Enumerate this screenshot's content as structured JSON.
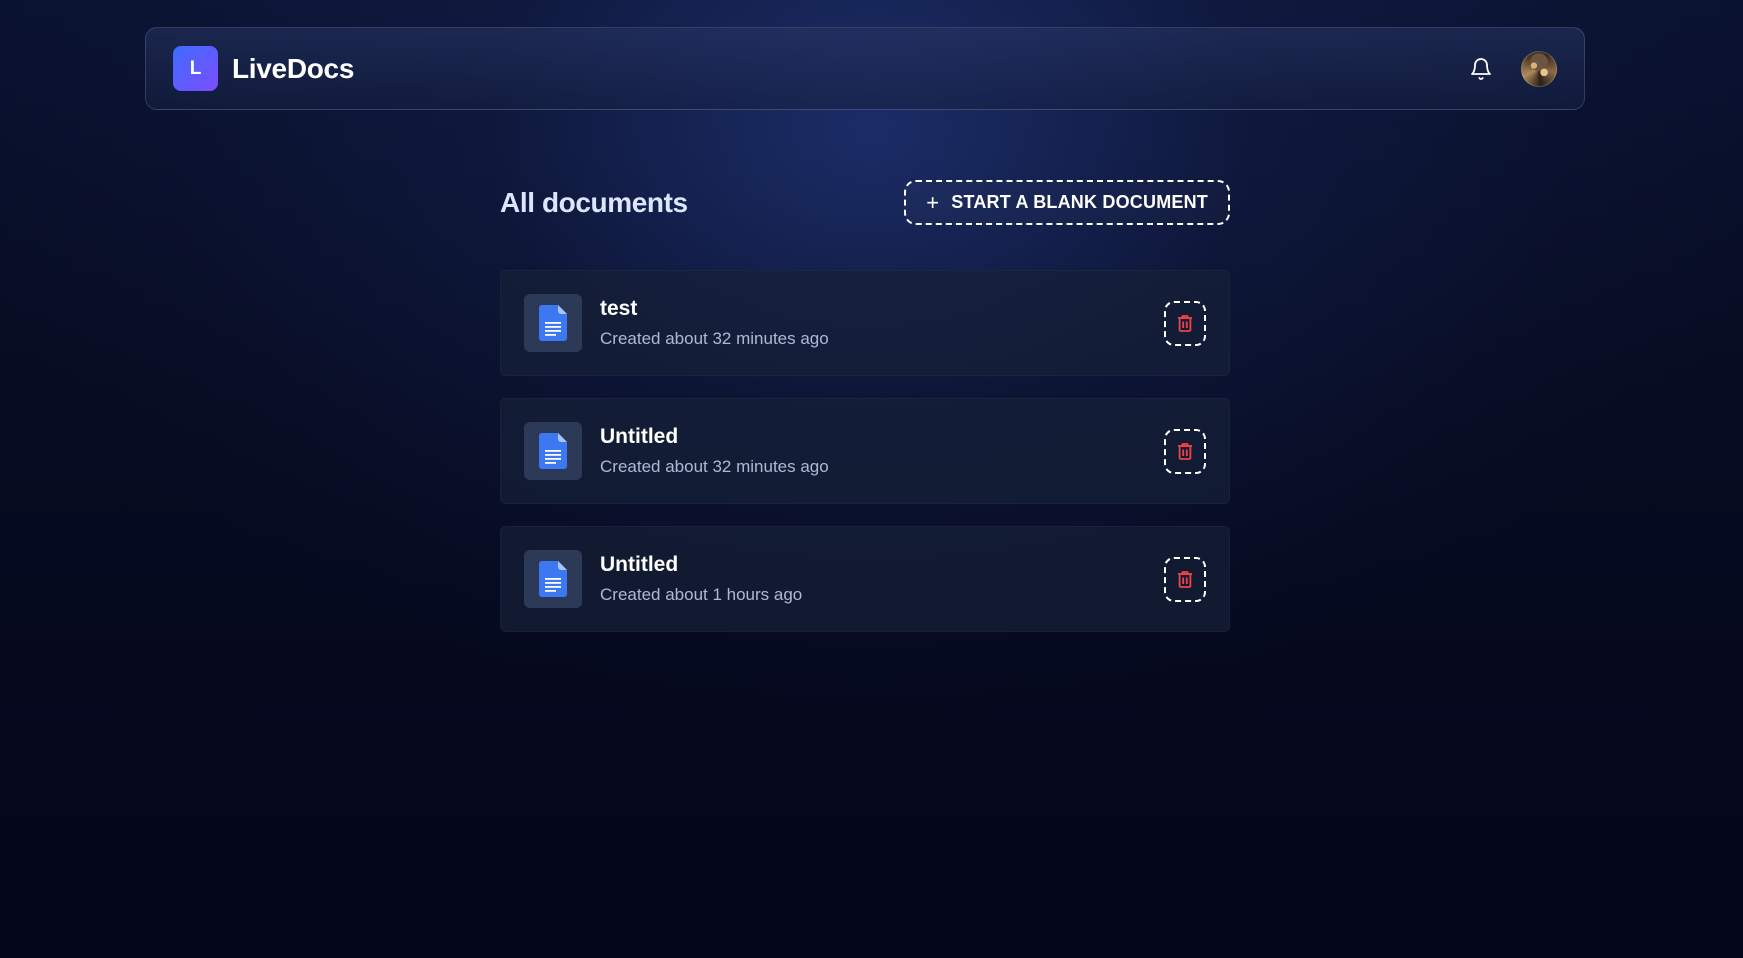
{
  "app": {
    "logo_letter": "L",
    "name": "LiveDocs"
  },
  "header": {
    "notifications_icon": "bell-icon",
    "avatar": "user-avatar"
  },
  "main": {
    "title": "All documents",
    "new_button": {
      "icon": "plus-icon",
      "label": "START A BLANK DOCUMENT"
    },
    "documents": [
      {
        "title": "test",
        "meta": "Created about 32 minutes ago"
      },
      {
        "title": "Untitled",
        "meta": "Created about 32 minutes ago"
      },
      {
        "title": "Untitled",
        "meta": "Created about 1 hours ago"
      }
    ]
  },
  "colors": {
    "background": "#05081a",
    "logo_gradient_start": "#3f6bff",
    "logo_gradient_end": "#7b4dff",
    "doc_icon_blue": "#3b78f2",
    "delete_red": "#ef4444",
    "card_bg": "#161f38",
    "meta_text": "#aeb9d4"
  }
}
